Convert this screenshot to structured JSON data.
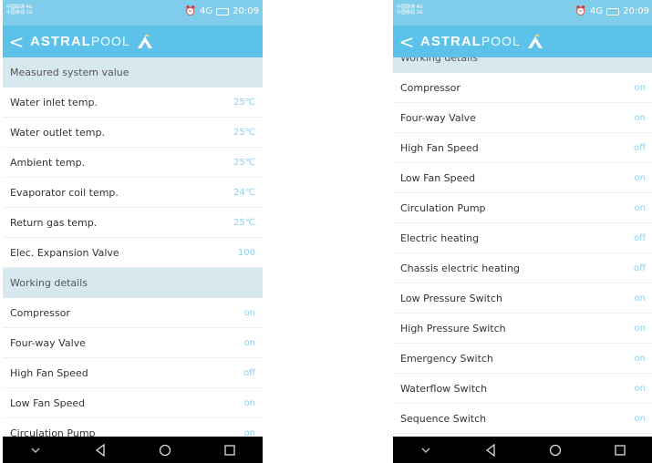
{
  "status": {
    "carrier_lines": [
      "中国联通 4G",
      "中国移动 2G"
    ],
    "signal": "4G",
    "time": "20:09"
  },
  "appbar": {
    "back_glyph": "<",
    "brand_bold": "ASTRAL",
    "brand_light": "POOL",
    "logo_icon": "astralpool-logo-icon"
  },
  "left": {
    "sections": [
      {
        "title": "Measured system value",
        "rows": [
          {
            "label": "Water inlet temp.",
            "value": "25℃"
          },
          {
            "label": "Water outlet temp.",
            "value": "25℃"
          },
          {
            "label": "Ambient temp.",
            "value": "25℃"
          },
          {
            "label": "Evaporator coil temp.",
            "value": "24℃"
          },
          {
            "label": "Return gas temp.",
            "value": "25℃"
          },
          {
            "label": "Elec. Expansion Valve",
            "value": "100"
          }
        ]
      },
      {
        "title": "Working details",
        "rows": [
          {
            "label": "Compressor",
            "value": "on"
          },
          {
            "label": "Four-way Valve",
            "value": "on"
          },
          {
            "label": "High Fan Speed",
            "value": "off"
          },
          {
            "label": "Low Fan Speed",
            "value": "on"
          },
          {
            "label": "Circulation Pump",
            "value": "on"
          }
        ]
      }
    ]
  },
  "right": {
    "section_title": "Working details",
    "rows": [
      {
        "label": "Compressor",
        "value": "on"
      },
      {
        "label": "Four-way Valve",
        "value": "on"
      },
      {
        "label": "High Fan Speed",
        "value": "off"
      },
      {
        "label": "Low Fan Speed",
        "value": "on"
      },
      {
        "label": "Circulation Pump",
        "value": "on"
      },
      {
        "label": "Electric heating",
        "value": "off"
      },
      {
        "label": "Chassis electric heating",
        "value": "off"
      },
      {
        "label": "Low Pressure Switch",
        "value": "on"
      },
      {
        "label": "High Pressure Switch",
        "value": "on"
      },
      {
        "label": "Emergency Switch",
        "value": "on"
      },
      {
        "label": "Waterflow Switch",
        "value": "on"
      },
      {
        "label": "Sequence Switch",
        "value": "on"
      }
    ]
  },
  "navbar": {
    "icons": [
      "chevron-down-icon",
      "back-icon",
      "home-icon",
      "recents-icon"
    ]
  },
  "colors": {
    "appbar": "#5cc2ea",
    "statusbar": "#7fcdea",
    "section": "#d7e8ee",
    "value": "#8fd0ec"
  }
}
